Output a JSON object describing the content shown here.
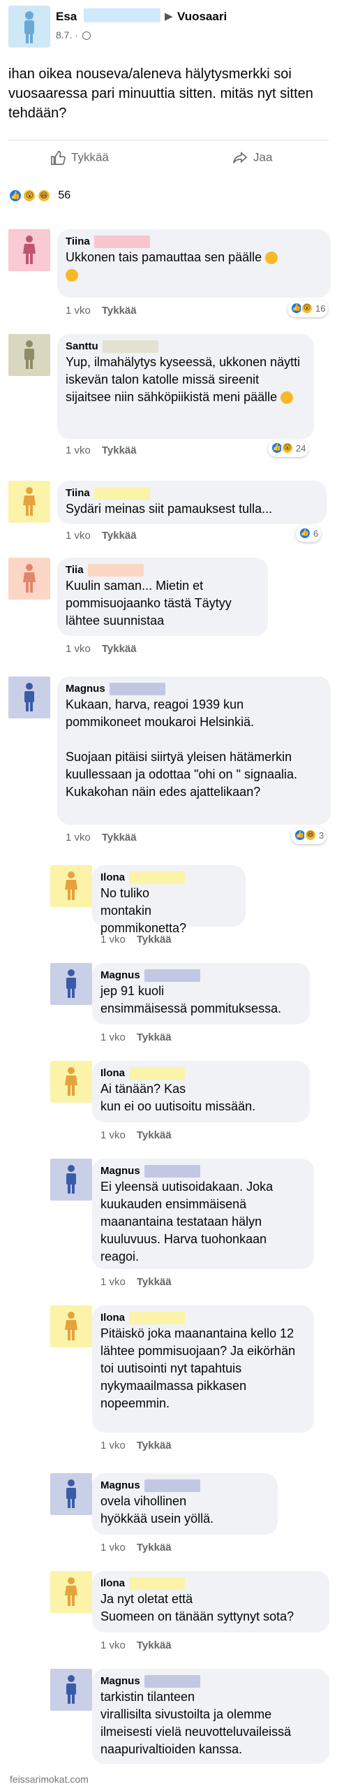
{
  "post": {
    "author": "Esa",
    "place": "Vuosaari",
    "time": "8.7.",
    "separator": "·",
    "text": "ihan oikea nouseva/aleneva hälytysmerkki soi vuosaaressa pari minuuttia sitten. mitäs nyt sitten tehdään?",
    "like_label": "Tykkää",
    "share_label": "Jaa",
    "reaction_count": "56",
    "avatar_color": "#cfe8f7"
  },
  "comments": [
    {
      "name": "Tiina",
      "text": "Ukkonen tais pamauttaa sen päälle",
      "time": "1 vko",
      "like": "Tykkää",
      "reactions": "16",
      "avatar_color": "#f9c9d4",
      "redact_color": "#f9c6cf"
    },
    {
      "name": "Santtu",
      "text": "Yup, ilmahälytys kyseessä, ukkonen näytti iskevän talon katolle missä sireenit sijaitsee niin sähköpiikistä meni päälle",
      "time": "1 vko",
      "like": "Tykkää",
      "reactions": "24",
      "avatar_color": "#d9d7c0",
      "redact_color": "#e3e1d0"
    },
    {
      "name": "Tiina",
      "text": "Sydäri meinas siit pamauksest tulla...",
      "time": "1 vko",
      "like": "Tykkää",
      "reactions": "6",
      "avatar_color": "#fbf3a8",
      "redact_color": "#fbf3a8"
    },
    {
      "name": "Tiia",
      "text": "Kuulin saman... Mietin et pommisuojaanko tästä Täytyy lähtee suunnistaa",
      "time": "1 vko",
      "like": "Tykkää",
      "reactions": "",
      "avatar_color": "#fcd6c4",
      "redact_color": "#fcd6c4"
    },
    {
      "name": "Magnus",
      "text": "Kukaan, harva, reagoi 1939 kun pommikoneet moukaroi Helsinkiä.\n\nSuojaan pitäisi siirtyä yleisen hätämerkin kuullessaan ja odottaa \"ohi on \" signaalia. Kukakohan näin edes ajattelikaan?",
      "time": "1 vko",
      "like": "Tykkää",
      "reactions": "3",
      "avatar_color": "#c9cfe6",
      "redact_color": "#c2c7e3"
    }
  ],
  "replies": [
    {
      "name": "Ilona",
      "text": "No tuliko\nmontakin pommikonetta?",
      "time": "1 vko",
      "like": "Tykkää",
      "avatar_color": "#fbf3a8",
      "redact_color": "#fbf3a8"
    },
    {
      "name": "Magnus",
      "text": "jep 91 kuoli\nensimmäisessä pommituksessa.",
      "time": "1 vko",
      "like": "Tykkää",
      "avatar_color": "#c9cfe6",
      "redact_color": "#c2c7e3"
    },
    {
      "name": "Ilona",
      "text": "Ai tänään? Kas\nkun ei oo uutisoitu missään.",
      "time": "1 vko",
      "like": "Tykkää",
      "avatar_color": "#fbf3a8",
      "redact_color": "#fbf3a8"
    },
    {
      "name": "Magnus",
      "text": "Ei yleensä uutisoidakaan. Joka kuukauden ensimmäisenä maanantaina testataan hälyn kuuluvuus. Harva tuohonkaan reagoi.",
      "time": "1 vko",
      "like": "Tykkää",
      "avatar_color": "#c9cfe6",
      "redact_color": "#c2c7e3"
    },
    {
      "name": "Ilona",
      "text": "Pitäiskö joka maanantaina kello 12 lähtee pommisuojaan? Ja eikörhän toi uutisointi nyt tapahtuis nykymaailmassa pikkasen nopeemmin.",
      "time": "1 vko",
      "like": "Tykkää",
      "avatar_color": "#fbf3a8",
      "redact_color": "#fbf3a8"
    },
    {
      "name": "Magnus",
      "text": "ovela vihollinen\nhyökkää usein yöllä.",
      "time": "1 vko",
      "like": "Tykkää",
      "avatar_color": "#c9cfe6",
      "redact_color": "#c2c7e3"
    },
    {
      "name": "Ilona",
      "text": "Ja nyt oletat että\nSuomeen on tänään syttynyt sota?",
      "time": "1 vko",
      "like": "Tykkää",
      "avatar_color": "#fbf3a8",
      "redact_color": "#fbf3a8"
    },
    {
      "name": "Magnus",
      "text": "tarkistin tilanteen\nvirallisilta sivustoilta ja olemme ilmeisesti vielä neuvotteluvaileissä naapurivaltioiden kanssa.",
      "time": "",
      "like": "",
      "avatar_color": "#c9cfe6",
      "redact_color": "#c2c7e3"
    }
  ],
  "watermark": "feissarimokat.com",
  "colors": {
    "like_blue": "#1877f2",
    "emoji_yellow": "#f7b928",
    "bubble_gray": "#f0f2f5",
    "person_icon": "#3b5ba9"
  }
}
